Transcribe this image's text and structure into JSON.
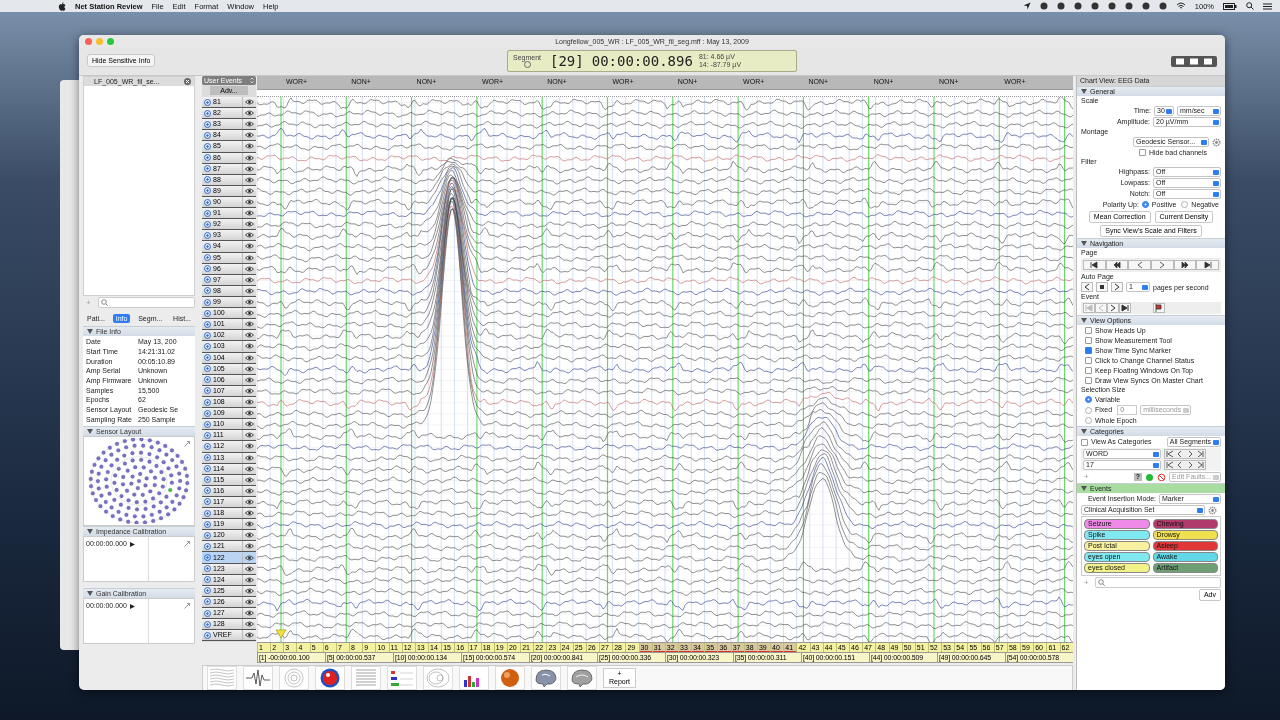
{
  "menu_bar": {
    "app": "Net Station Review",
    "items": [
      "File",
      "Edit",
      "Format",
      "Window",
      "Help"
    ],
    "battery": "100%"
  },
  "window": {
    "title": "Longfellow_005_WR : LF_005_WR_fil_seg.mff : May 13, 2009"
  },
  "toolbar": {
    "hide_button": "Hide Sensitive Info",
    "segment_label": "Segment",
    "segment_number": "[29]",
    "time": "00:00:00.896",
    "readings": [
      "81: 4.66 µV",
      "14: -87.79 µV"
    ]
  },
  "file_list": {
    "files": [
      {
        "name": "LF_005_WR_fil_se...",
        "selected": true
      }
    ],
    "add": "+"
  },
  "info_tabs": [
    {
      "label": "Pati...",
      "selected": false
    },
    {
      "label": "Info",
      "selected": true
    },
    {
      "label": "Segm...",
      "selected": false
    },
    {
      "label": "Hist...",
      "selected": false
    }
  ],
  "file_info": {
    "title": "File Info",
    "rows": [
      {
        "label": "Date",
        "value": "May 13, 200"
      },
      {
        "label": "Start Time",
        "value": "14:21:31.02"
      },
      {
        "label": "Duration",
        "value": "00:05:10.89"
      },
      {
        "label": "Amp Serial",
        "value": "Unknown"
      },
      {
        "label": "Amp Firmware",
        "value": "Unknown"
      },
      {
        "label": "Samples",
        "value": "15,500"
      },
      {
        "label": "Epochs",
        "value": "62"
      },
      {
        "label": "Sensor Layout",
        "value": "Geodesic Se"
      },
      {
        "label": "Sampling Rate",
        "value": "250 Sample"
      }
    ]
  },
  "sensor_layout": {
    "title": "Sensor Layout"
  },
  "impedance": {
    "title": "Impedance Calibration",
    "time": "00:00:00.000"
  },
  "gain": {
    "title": "Gain Calibration",
    "time": "00:00:00.000"
  },
  "channel_header": {
    "events_menu": "User Events",
    "adv": "Adv..."
  },
  "channels": [
    {
      "label": "81",
      "selected": false
    },
    {
      "label": "82",
      "selected": false
    },
    {
      "label": "83",
      "selected": false
    },
    {
      "label": "84",
      "selected": false
    },
    {
      "label": "85",
      "selected": false
    },
    {
      "label": "86",
      "selected": false
    },
    {
      "label": "87",
      "selected": false
    },
    {
      "label": "88",
      "selected": false
    },
    {
      "label": "89",
      "selected": false
    },
    {
      "label": "90",
      "selected": false
    },
    {
      "label": "91",
      "selected": false
    },
    {
      "label": "92",
      "selected": false
    },
    {
      "label": "93",
      "selected": false
    },
    {
      "label": "94",
      "selected": false
    },
    {
      "label": "95",
      "selected": false
    },
    {
      "label": "96",
      "selected": false
    },
    {
      "label": "97",
      "selected": false
    },
    {
      "label": "98",
      "selected": false
    },
    {
      "label": "99",
      "selected": false
    },
    {
      "label": "100",
      "selected": false
    },
    {
      "label": "101",
      "selected": false
    },
    {
      "label": "102",
      "selected": false
    },
    {
      "label": "103",
      "selected": false
    },
    {
      "label": "104",
      "selected": false
    },
    {
      "label": "105",
      "selected": false
    },
    {
      "label": "106",
      "selected": false
    },
    {
      "label": "107",
      "selected": false
    },
    {
      "label": "108",
      "selected": false
    },
    {
      "label": "109",
      "selected": false
    },
    {
      "label": "110",
      "selected": false
    },
    {
      "label": "111",
      "selected": false
    },
    {
      "label": "112",
      "selected": false
    },
    {
      "label": "113",
      "selected": false
    },
    {
      "label": "114",
      "selected": false
    },
    {
      "label": "115",
      "selected": false
    },
    {
      "label": "116",
      "selected": false
    },
    {
      "label": "117",
      "selected": false
    },
    {
      "label": "118",
      "selected": false
    },
    {
      "label": "119",
      "selected": false
    },
    {
      "label": "120",
      "selected": false
    },
    {
      "label": "121",
      "selected": false
    },
    {
      "label": "122",
      "selected": true
    },
    {
      "label": "123",
      "selected": false
    },
    {
      "label": "124",
      "selected": false
    },
    {
      "label": "125",
      "selected": false
    },
    {
      "label": "126",
      "selected": false
    },
    {
      "label": "127",
      "selected": false
    },
    {
      "label": "128",
      "selected": false
    },
    {
      "label": "VREF",
      "selected": false
    }
  ],
  "event_markers": [
    "WOR+",
    "NON+",
    "NON+",
    "WOR+",
    "NON+",
    "WOR+",
    "NON+",
    "WOR+",
    "NON+",
    "NON+",
    "NON+",
    "WOR+"
  ],
  "pages": [
    {
      "label": "1",
      "selected": false
    },
    {
      "label": "2",
      "selected": false
    },
    {
      "label": "3",
      "selected": false
    },
    {
      "label": "4",
      "selected": false
    },
    {
      "label": "5",
      "selected": false
    },
    {
      "label": "6",
      "selected": false
    },
    {
      "label": "7",
      "selected": false
    },
    {
      "label": "8",
      "selected": false
    },
    {
      "label": "9",
      "selected": false
    },
    {
      "label": "10",
      "selected": false
    },
    {
      "label": "11",
      "selected": false
    },
    {
      "label": "12",
      "selected": false
    },
    {
      "label": "13",
      "selected": false
    },
    {
      "label": "14",
      "selected": false
    },
    {
      "label": "15",
      "selected": false
    },
    {
      "label": "16",
      "selected": false
    },
    {
      "label": "17",
      "selected": false
    },
    {
      "label": "18",
      "selected": false
    },
    {
      "label": "19",
      "selected": false
    },
    {
      "label": "20",
      "selected": false
    },
    {
      "label": "21",
      "selected": false
    },
    {
      "label": "22",
      "selected": false
    },
    {
      "label": "23",
      "selected": false
    },
    {
      "label": "24",
      "selected": false
    },
    {
      "label": "25",
      "selected": false
    },
    {
      "label": "26",
      "selected": false
    },
    {
      "label": "27",
      "selected": false
    },
    {
      "label": "28",
      "selected": false
    },
    {
      "label": "29",
      "selected": false
    },
    {
      "label": "30",
      "selected": true
    },
    {
      "label": "31",
      "selected": true
    },
    {
      "label": "32",
      "selected": true
    },
    {
      "label": "33",
      "selected": true
    },
    {
      "label": "34",
      "selected": true
    },
    {
      "label": "35",
      "selected": true
    },
    {
      "label": "36",
      "selected": true
    },
    {
      "label": "37",
      "selected": true
    },
    {
      "label": "38",
      "selected": true
    },
    {
      "label": "39",
      "selected": true
    },
    {
      "label": "40",
      "selected": true
    },
    {
      "label": "41",
      "selected": true
    },
    {
      "label": "42",
      "selected": false
    },
    {
      "label": "43",
      "selected": false
    },
    {
      "label": "44",
      "selected": false
    },
    {
      "label": "45",
      "selected": false
    },
    {
      "label": "46",
      "selected": false
    },
    {
      "label": "47",
      "selected": false
    },
    {
      "label": "48",
      "selected": false
    },
    {
      "label": "49",
      "selected": false
    },
    {
      "label": "50",
      "selected": false
    },
    {
      "label": "51",
      "selected": false
    },
    {
      "label": "52",
      "selected": false
    },
    {
      "label": "53",
      "selected": false
    },
    {
      "label": "54",
      "selected": false
    },
    {
      "label": "55",
      "selected": false
    },
    {
      "label": "56",
      "selected": false
    },
    {
      "label": "57",
      "selected": false
    },
    {
      "label": "58",
      "selected": false
    },
    {
      "label": "59",
      "selected": false
    },
    {
      "label": "60",
      "selected": false
    },
    {
      "label": "61",
      "selected": false
    },
    {
      "label": "62",
      "selected": false
    }
  ],
  "segment_times": [
    "[1] -00:00:00.100",
    "[5] 00:00:00.537",
    "[10] 00:00:00.134",
    "[15] 00:00:00.574",
    "[20] 00:00:00.841",
    "[25] 00:00:00.336",
    "[30] 00:00:00.323",
    "[35] 00:00:00.311",
    "[40] 00:00:00.151",
    "[44] 00:00:00.509",
    "[49] 00:00:00.645",
    "[54] 00:00:00.578"
  ],
  "tools": {
    "report_plus": "+",
    "report": "Report"
  },
  "right_panel": {
    "title": "Chart View: EEG Data"
  },
  "general": {
    "title": "General",
    "scale_label": "Scale",
    "time_label": "Time:",
    "time_value": "30",
    "time_unit": "mm/sec",
    "amplitude_label": "Amplitude:",
    "amplitude_value": "20 µV/mm",
    "montage_label": "Montage",
    "montage_value": "Geodesic Sensor...",
    "hide_bad": {
      "label": "Hide bad channels",
      "checked": false
    },
    "filter_label": "Filter",
    "filters": [
      {
        "label": "Highpass:",
        "value": "Off"
      },
      {
        "label": "Lowpass:",
        "value": "Off"
      },
      {
        "label": "Notch:",
        "value": "Off"
      }
    ],
    "polarity_label": "Polarity Up:",
    "polarity": [
      {
        "label": "Positive",
        "selected": true
      },
      {
        "label": "Negative",
        "selected": false
      }
    ],
    "buttons": [
      "Mean Correction",
      "Current Density"
    ],
    "sync_button": "Sync View's Scale and Filters"
  },
  "navigation": {
    "title": "Navigation",
    "page_label": "Page",
    "auto_label": "Auto Page",
    "auto_value": "1",
    "auto_unit": "pages per second",
    "event_label": "Event"
  },
  "view_options": {
    "title": "View Options",
    "checks": [
      {
        "label": "Show Heads Up",
        "checked": false
      },
      {
        "label": "Show Measurement Tool",
        "checked": false
      },
      {
        "label": "Show Time Sync Marker",
        "checked": true
      },
      {
        "label": "Click to Change Channel Status",
        "checked": false
      },
      {
        "label": "Keep Floating Windows On Top",
        "checked": false
      },
      {
        "label": "Draw View Syncs On Master Chart",
        "checked": false
      }
    ],
    "size_label": "Selection Size",
    "sizes": [
      {
        "label": "Variable",
        "selected": true
      },
      {
        "label": "Fixed",
        "selected": false
      },
      {
        "label": "Whole Epoch",
        "selected": false
      }
    ],
    "fixed_value": "0",
    "fixed_unit": "milliseconds"
  },
  "categories": {
    "title": "Categories",
    "view_as": {
      "label": "View As Categories",
      "checked": false
    },
    "segments": "All Segments",
    "rows": [
      "WORD",
      "17"
    ],
    "add": "+",
    "help": "?",
    "edit_faults": "Edit Faults..."
  },
  "events": {
    "title": "Events",
    "mode_label": "Event Insertion Mode:",
    "mode_value": "Marker",
    "set": "Clinical Acquisition Set",
    "tags": [
      {
        "label": "Seizure",
        "color": "#f08ae8"
      },
      {
        "label": "Chewing",
        "color": "#b03a6a"
      },
      {
        "label": "Spike",
        "color": "#80e8f0"
      },
      {
        "label": "Drowsy",
        "color": "#f0e050"
      },
      {
        "label": "Post Ictal",
        "color": "#f8f2a0"
      },
      {
        "label": "Asleep",
        "color": "#e03838"
      },
      {
        "label": "eyes open",
        "color": "#80e8f0"
      },
      {
        "label": "Awake",
        "color": "#60d8e8"
      },
      {
        "label": "eyes closed",
        "color": "#f2f288"
      },
      {
        "label": "Artifact",
        "color": "#6e9e74"
      }
    ],
    "add": "+",
    "adv": "Adv"
  }
}
